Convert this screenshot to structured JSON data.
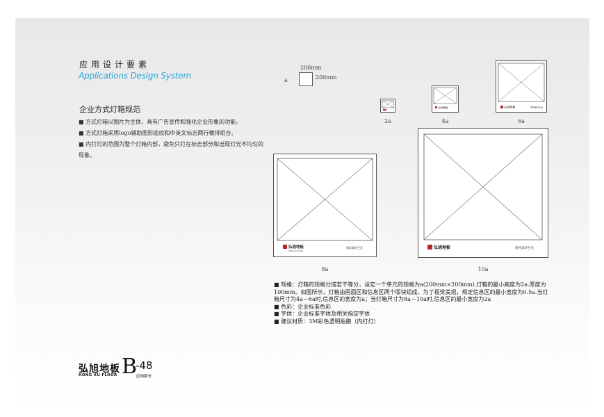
{
  "header": {
    "title_cn": "应用设计要素",
    "title_en": "Applications Design System"
  },
  "section": {
    "title": "企业方式灯箱规范",
    "bullets": [
      "■ 方式灯箱以图片为主体，具有广告宣传和强化企业形象的功能。",
      "■ 方式灯箱采用logo辅助图形底纹和中英文标志两行横排组合。",
      "■ 内打灯的范围为整个灯箱内部，避免只打在标志部分和出现灯光不均匀的现象。"
    ]
  },
  "unit": {
    "label": "a",
    "width": "200mm",
    "height": "200mm"
  },
  "lightboxes": {
    "size_2a": {
      "label": "2a"
    },
    "size_4a": {
      "label": "4a",
      "logo": "弘旭地板",
      "slogan": "倡导美好生活"
    },
    "size_6a": {
      "label": "6a",
      "logo": "弘旭地板",
      "slogan": "倡导美好生活"
    },
    "size_8a": {
      "label": "8a",
      "logo": "弘旭地板",
      "logo_en": "HONG XU FLOOR",
      "slogan": "倡导美好生活"
    },
    "size_10a": {
      "label": "10a",
      "logo": "弘旭地板",
      "slogan": "倡导美好生活"
    }
  },
  "specs": {
    "line1": "■ 规格：灯箱的规格分成若干等分，设定一个单元的规格为a(200mm×200mm).灯箱的最小高度为2a.厚度为",
    "line2": "100mm。如图所示，灯箱由画面区和信息区两个版块组成，为了视觉美观，规定信息区的最小宽度为0.5a.当灯",
    "line3": "箱尺寸为4a－6a时,信息区的宽度为a；当灯箱尺寸为8a－10a时,信息区的最小宽度为2a",
    "line4": "■ 色彩：企业标准色彩",
    "line5": "■ 字体：企业标准字体及相关指定字体",
    "line6": "■ 建议材质：3M彩色透明贴膜（内打灯）"
  },
  "footer": {
    "brand_cn": "弘旭地板",
    "brand_en": "HONG XU FLOOR",
    "page_letter": "B",
    "page_number": "-48",
    "page_sub": "应用部分"
  },
  "colors": {
    "accent": "#27a6d8",
    "logo_red": "#b3262d"
  }
}
